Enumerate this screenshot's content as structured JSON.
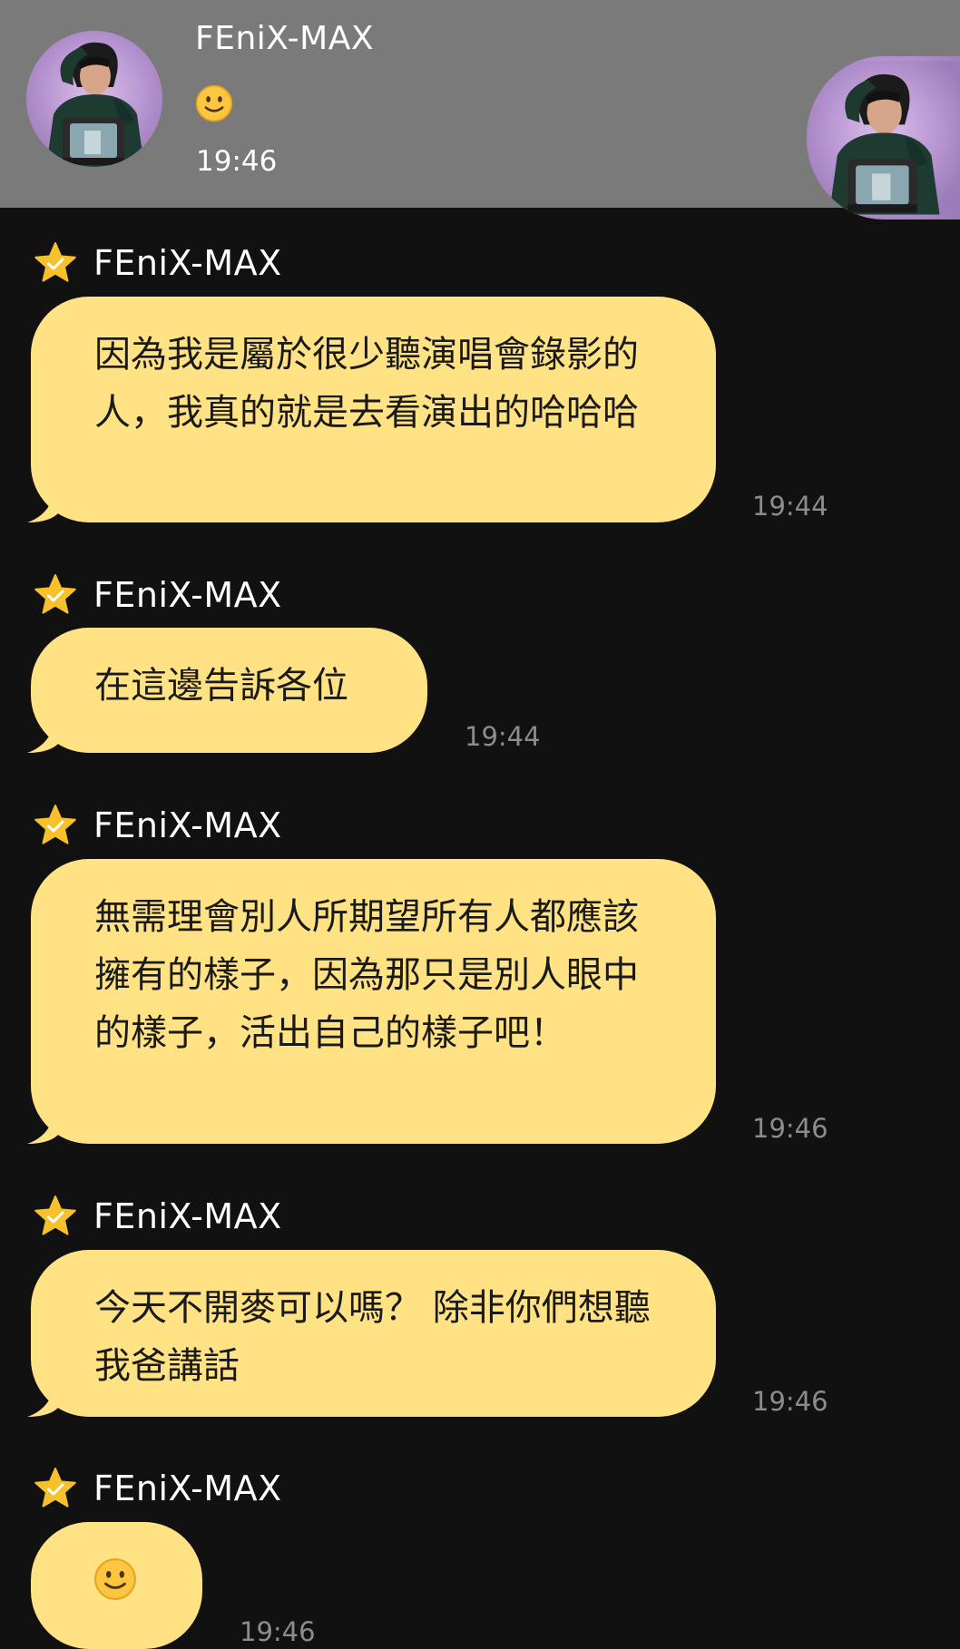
{
  "header": {
    "name": "FEniX-MAX",
    "time": "19:46",
    "status_emoji": "slightly-smiling-face-icon"
  },
  "messages": [
    {
      "sender": "FEniX-MAX",
      "text": "因為我是屬於很少聽演唱會錄影的人，我真的就是去看演出的哈哈哈",
      "time": "19:44"
    },
    {
      "sender": "FEniX-MAX",
      "text": "在這邊告訴各位",
      "time": "19:44"
    },
    {
      "sender": "FEniX-MAX",
      "text": "無需理會別人所期望所有人都應該擁有的樣子，因為那只是別人眼中的樣子，活出自己的樣子吧！",
      "time": "19:46"
    },
    {
      "sender": "FEniX-MAX",
      "text": "今天不開麥可以嗎？ 除非你們想聽我爸講話",
      "time": "19:46"
    },
    {
      "sender": "FEniX-MAX",
      "emoji": "slightly-smiling-face-icon",
      "time": "19:46"
    }
  ],
  "colors": {
    "background": "#111111",
    "header": "#7a7a7a",
    "bubble": "#ffe283",
    "time": "#8c8c8c",
    "star": "#f6c12a"
  }
}
